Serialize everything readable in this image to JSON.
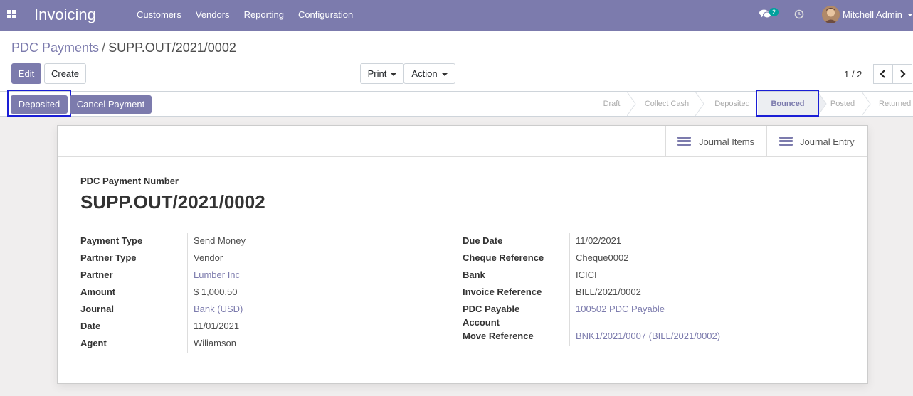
{
  "navbar": {
    "brand": "Invoicing",
    "menu": [
      "Customers",
      "Vendors",
      "Reporting",
      "Configuration"
    ],
    "chat_count": "2",
    "user_name": "Mitchell Admin"
  },
  "breadcrumb": {
    "parent": "PDC Payments",
    "separator": "/",
    "current": "SUPP.OUT/2021/0002"
  },
  "toolbar": {
    "edit": "Edit",
    "create": "Create",
    "print": "Print",
    "action": "Action"
  },
  "pager": {
    "value": "1 / 2"
  },
  "status_buttons": {
    "deposited": "Deposited",
    "cancel": "Cancel Payment"
  },
  "stages": [
    "Draft",
    "Collect Cash",
    "Deposited",
    "Bounced",
    "Posted",
    "Returned"
  ],
  "active_stage": "Bounced",
  "smart_buttons": {
    "journal_items": "Journal Items",
    "journal_entry": "Journal Entry"
  },
  "record": {
    "title_label": "PDC Payment Number",
    "title": "SUPP.OUT/2021/0002",
    "left": [
      {
        "label": "Payment Type",
        "value": "Send Money"
      },
      {
        "label": "Partner Type",
        "value": "Vendor"
      },
      {
        "label": "Partner",
        "value": "Lumber Inc"
      },
      {
        "label": "Amount",
        "value": "$ 1,000.50"
      },
      {
        "label": "Journal",
        "value": "Bank (USD)"
      },
      {
        "label": "Date",
        "value": "11/01/2021"
      },
      {
        "label": "Agent",
        "value": "Wiliamson"
      }
    ],
    "right": [
      {
        "label": "Due Date",
        "value": "11/02/2021"
      },
      {
        "label": "Cheque Reference",
        "value": "Cheque0002"
      },
      {
        "label": "Bank",
        "value": "ICICI"
      },
      {
        "label": "Invoice Reference",
        "value": "BILL/2021/0002"
      },
      {
        "label": "PDC Payable",
        "label2": "Account",
        "value": "100502 PDC Payable"
      },
      {
        "label": "Move Reference",
        "value": "BNK1/2021/0007 (BILL/2021/0002)"
      }
    ]
  },
  "colors": {
    "brand": "#7c7bad",
    "highlight": "#1a1ed6"
  }
}
